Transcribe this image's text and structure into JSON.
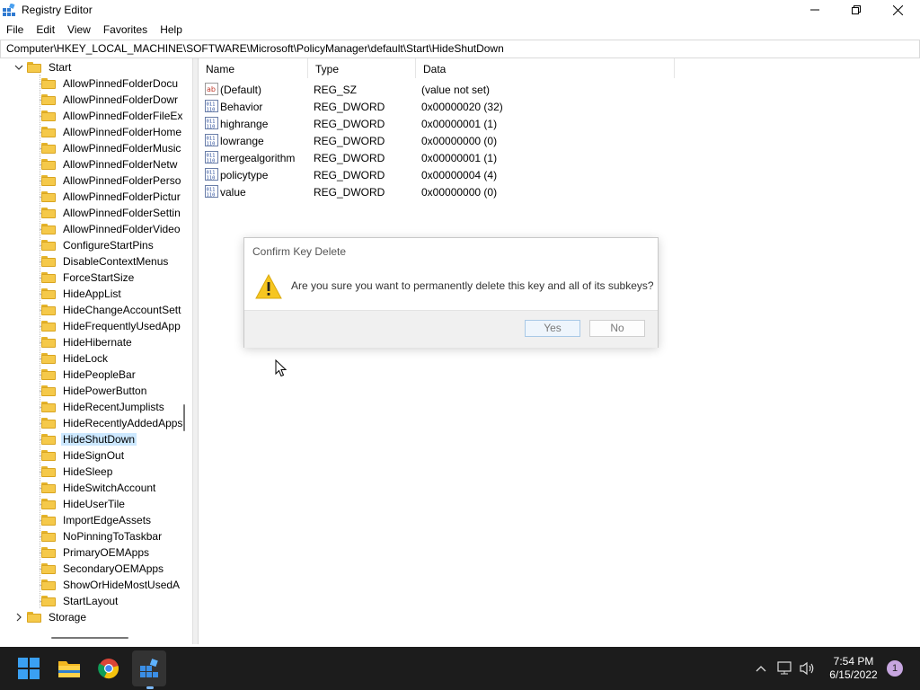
{
  "window": {
    "title": "Registry Editor"
  },
  "menu": [
    "File",
    "Edit",
    "View",
    "Favorites",
    "Help"
  ],
  "address": "Computer\\HKEY_LOCAL_MACHINE\\SOFTWARE\\Microsoft\\PolicyManager\\default\\Start\\HideShutDown",
  "tree": {
    "parent": "Start",
    "children": [
      "AllowPinnedFolderDocu",
      "AllowPinnedFolderDowr",
      "AllowPinnedFolderFileEx",
      "AllowPinnedFolderHomе",
      "AllowPinnedFolderMusic",
      "AllowPinnedFolderNetw",
      "AllowPinnedFolderPerso",
      "AllowPinnedFolderPictur",
      "AllowPinnedFolderSettin",
      "AllowPinnedFolderVideo",
      "ConfigureStartPins",
      "DisableContextMenus",
      "ForceStartSize",
      "HideAppList",
      "HideChangeAccountSett",
      "HideFrequentlyUsedApp",
      "HideHibernate",
      "HideLock",
      "HidePeopleBar",
      "HidePowerButton",
      "HideRecentJumplists",
      "HideRecentlyAddedApps",
      "HideShutDown",
      "HideSignOut",
      "HideSleep",
      "HideSwitchAccount",
      "HideUserTile",
      "ImportEdgeAssets",
      "NoPinningToTaskbar",
      "PrimaryOEMApps",
      "SecondaryOEMApps",
      "ShowOrHideMostUsedA",
      "StartLayout"
    ],
    "selected": "HideShutDown",
    "sibling": "Storage"
  },
  "list": {
    "columns": {
      "name": "Name",
      "type": "Type",
      "data": "Data"
    },
    "rows": [
      {
        "icon": "string-value-icon",
        "name": "(Default)",
        "type": "REG_SZ",
        "data": "(value not set)"
      },
      {
        "icon": "dword-value-icon",
        "name": "Behavior",
        "type": "REG_DWORD",
        "data": "0x00000020 (32)"
      },
      {
        "icon": "dword-value-icon",
        "name": "highrange",
        "type": "REG_DWORD",
        "data": "0x00000001 (1)"
      },
      {
        "icon": "dword-value-icon",
        "name": "lowrange",
        "type": "REG_DWORD",
        "data": "0x00000000 (0)"
      },
      {
        "icon": "dword-value-icon",
        "name": "mergealgorithm",
        "type": "REG_DWORD",
        "data": "0x00000001 (1)"
      },
      {
        "icon": "dword-value-icon",
        "name": "policytype",
        "type": "REG_DWORD",
        "data": "0x00000004 (4)"
      },
      {
        "icon": "dword-value-icon",
        "name": "value",
        "type": "REG_DWORD",
        "data": "0x00000000 (0)"
      }
    ]
  },
  "dialog": {
    "title": "Confirm Key Delete",
    "message": "Are you sure you want to permanently delete this key and all of its subkeys?",
    "yes": "Yes",
    "no": "No"
  },
  "taskbar": {
    "time": "7:54 PM",
    "date": "6/15/2022",
    "notifications": "1"
  },
  "colors": {
    "selection": "#cce8ff",
    "taskbar": "#1c1c1c",
    "folder": "#f5c94a",
    "accent": "#0067c0"
  }
}
